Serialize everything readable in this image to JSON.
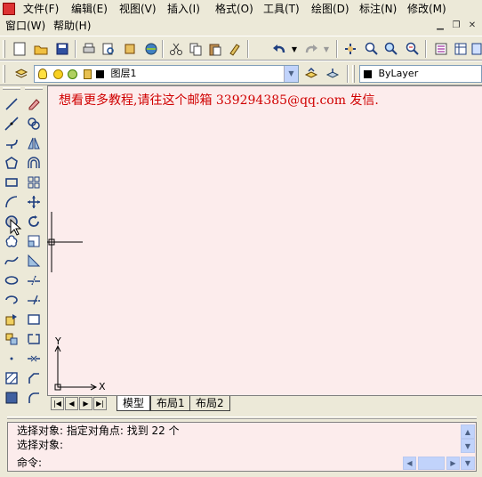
{
  "menu": {
    "row1": [
      {
        "label": "文件(F)",
        "name": "menu-file"
      },
      {
        "label": "编辑(E)",
        "name": "menu-edit"
      },
      {
        "label": "视图(V)",
        "name": "menu-view"
      },
      {
        "label": "插入(I)",
        "name": "menu-insert"
      },
      {
        "label": "格式(O)",
        "name": "menu-format"
      },
      {
        "label": "工具(T)",
        "name": "menu-tools"
      },
      {
        "label": "绘图(D)",
        "name": "menu-draw"
      },
      {
        "label": "标注(N)",
        "name": "menu-dimension"
      },
      {
        "label": "修改(M)",
        "name": "menu-modify"
      }
    ],
    "row2": [
      {
        "label": "窗口(W)",
        "name": "menu-window"
      },
      {
        "label": "帮助(H)",
        "name": "menu-help"
      }
    ]
  },
  "layers": {
    "current_layer": "图层1",
    "color_value": "ByLayer"
  },
  "canvas": {
    "promo_text": "想看更多教程,请往这个邮箱 339294385@qq.com 发信.",
    "ucs_x": "X",
    "ucs_y": "Y"
  },
  "tabs": [
    {
      "label": "模型",
      "active": true
    },
    {
      "label": "布局1",
      "active": false
    },
    {
      "label": "布局2",
      "active": false
    }
  ],
  "command": {
    "line1": "选择对象: 指定对角点: 找到 22 个",
    "line2": "选择对象:",
    "prompt": "命令:"
  },
  "colors": {
    "canvas_bg": "#fcecec",
    "promo_text": "#d00000",
    "chrome": "#ece9d8"
  }
}
